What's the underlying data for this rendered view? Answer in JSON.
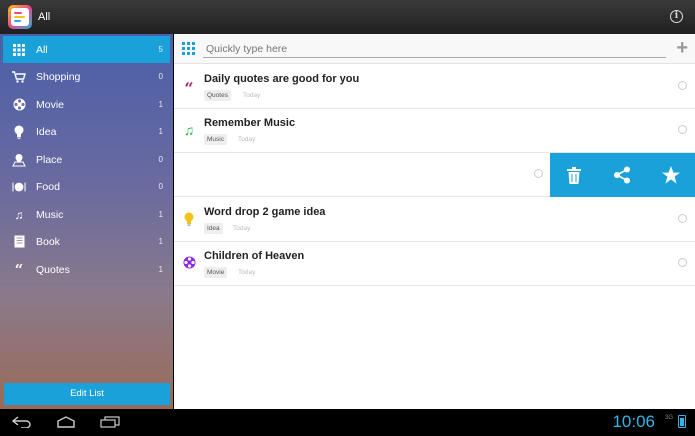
{
  "actionbar": {
    "title": "All"
  },
  "sidebar": {
    "items": [
      {
        "label": "All",
        "count": "5",
        "icon": "grid-icon"
      },
      {
        "label": "Shopping",
        "count": "0",
        "icon": "cart-icon"
      },
      {
        "label": "Movie",
        "count": "1",
        "icon": "film-reel-icon"
      },
      {
        "label": "Idea",
        "count": "1",
        "icon": "lightbulb-icon"
      },
      {
        "label": "Place",
        "count": "0",
        "icon": "map-pin-icon"
      },
      {
        "label": "Food",
        "count": "0",
        "icon": "plate-icon"
      },
      {
        "label": "Music",
        "count": "1",
        "icon": "music-note-icon"
      },
      {
        "label": "Book",
        "count": "1",
        "icon": "book-icon"
      },
      {
        "label": "Quotes",
        "count": "1",
        "icon": "quote-icon"
      }
    ],
    "edit_label": "Edit List"
  },
  "main": {
    "input_placeholder": "Quickly type here",
    "notes": [
      {
        "title": "Daily quotes are good for you",
        "tag": "Quotes",
        "time": "Today",
        "icon": "quote-icon",
        "color": "#a0287a"
      },
      {
        "title": "Remember Music",
        "tag": "Music",
        "time": "Today",
        "icon": "music-note-icon",
        "color": "#2fb34a"
      },
      {
        "title": "Word drop 2 game idea",
        "tag": "Idea",
        "time": "Today",
        "icon": "lightbulb-icon",
        "color": "#f4c21b"
      },
      {
        "title": "Children of Heaven",
        "tag": "Movie",
        "time": "Today",
        "icon": "film-reel-icon",
        "color": "#8a2be2"
      }
    ]
  },
  "statusbar": {
    "clock": "10:06",
    "network": "3G"
  },
  "colors": {
    "accent": "#1ba1d9",
    "clock": "#33b5e5"
  }
}
